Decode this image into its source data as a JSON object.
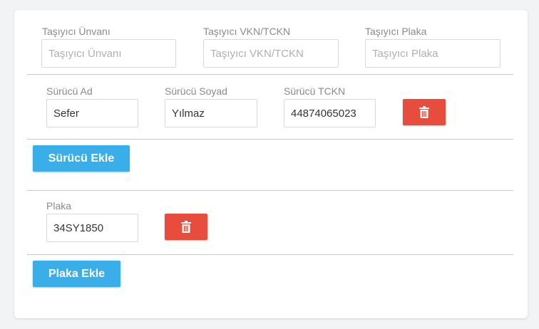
{
  "carrier": {
    "title_label": "Taşıyıcı Ünvanı",
    "title_placeholder": "Taşıyıcı Ünvanı",
    "title_value": "",
    "vkn_label": "Taşıyıcı VKN/TCKN",
    "vkn_placeholder": "Taşıyıcı VKN/TCKN",
    "vkn_value": "",
    "plate_label": "Taşıyıcı Plaka",
    "plate_placeholder": "Taşıyıcı Plaka",
    "plate_value": ""
  },
  "driver": {
    "first_name_label": "Sürücü Ad",
    "first_name_value": "Sefer",
    "last_name_label": "Sürücü Soyad",
    "last_name_value": "Yılmaz",
    "tckn_label": "Sürücü TCKN",
    "tckn_value": "44874065023",
    "add_button_label": "Sürücü Ekle",
    "delete_icon": "trash-icon"
  },
  "vehicle": {
    "plate_label": "Plaka",
    "plate_value": "34SY1850",
    "add_button_label": "Plaka Ekle",
    "delete_icon": "trash-icon"
  },
  "colors": {
    "primary": "#3aaee8",
    "danger": "#e74c3c",
    "label": "#8a8a8a",
    "divider": "#c8c8c8"
  }
}
